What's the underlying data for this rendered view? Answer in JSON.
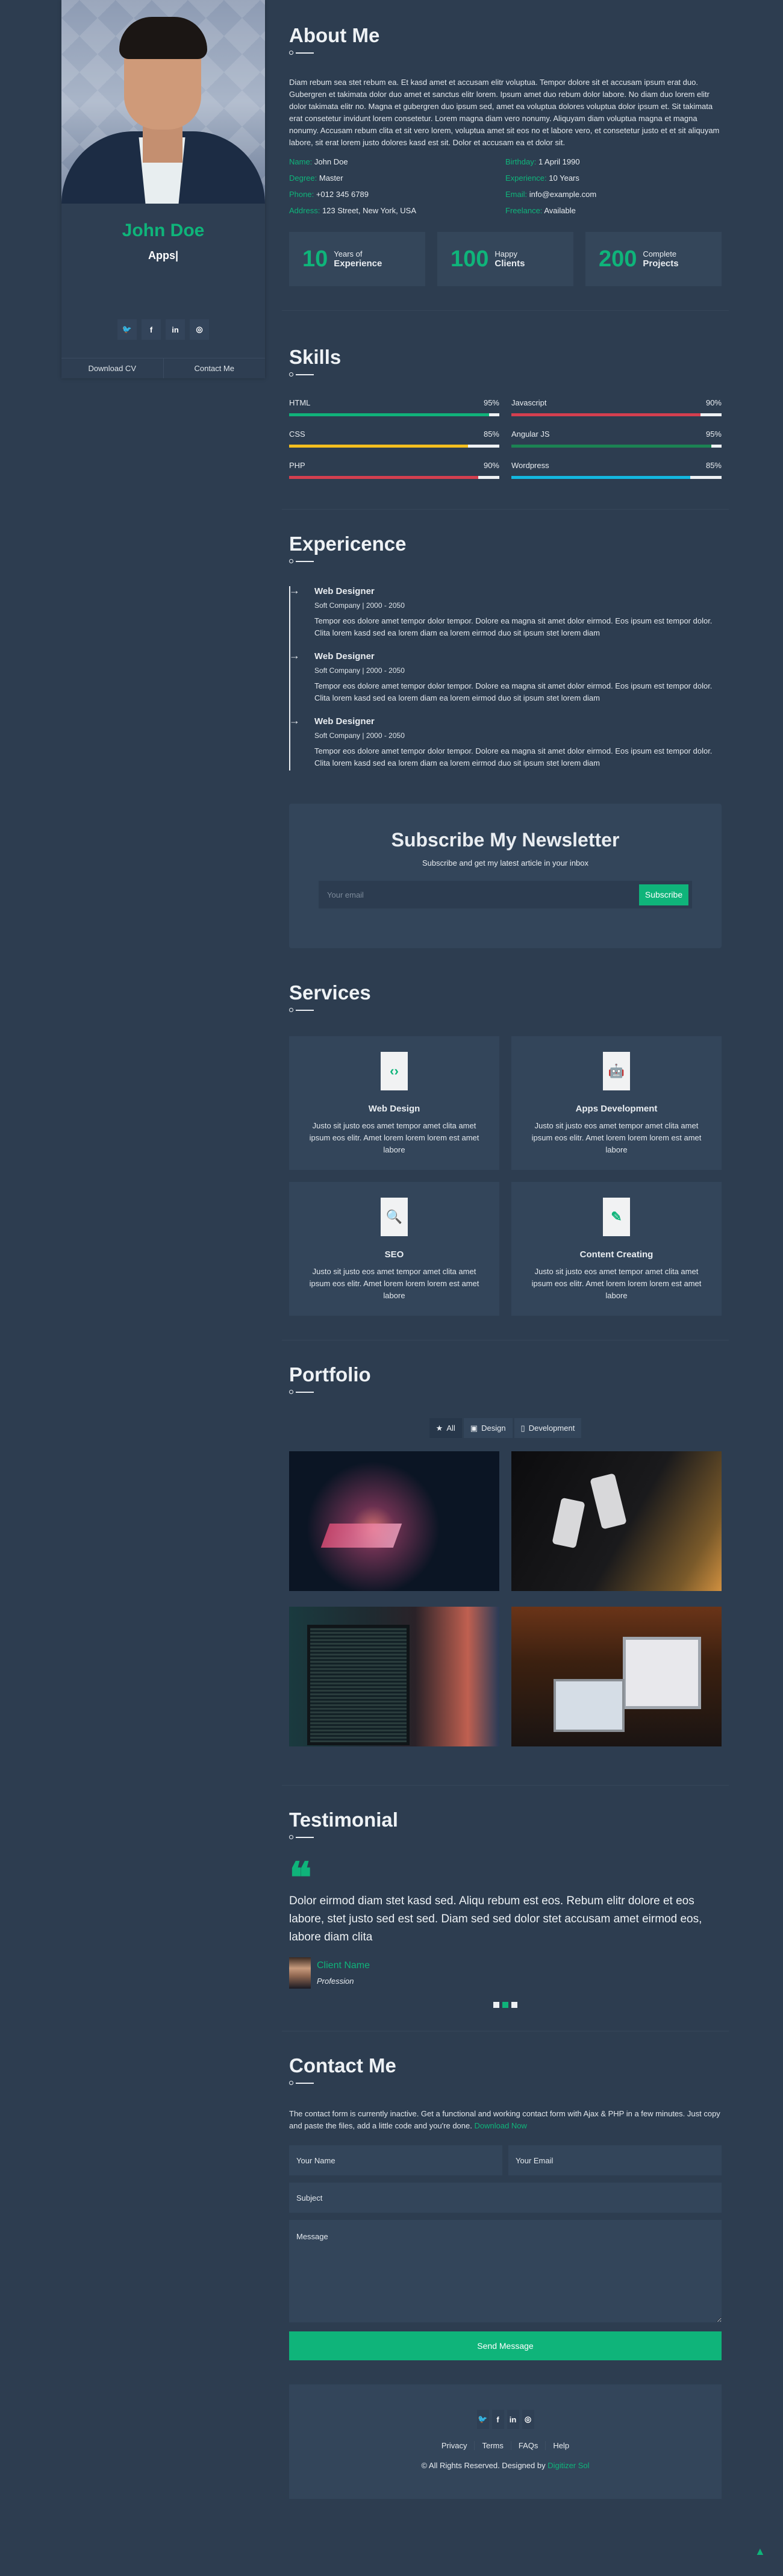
{
  "colors": {
    "accent": "#0fb47a",
    "background": "#2d3d50",
    "card": "#33455a"
  },
  "sidebar": {
    "name": "John Doe",
    "role": "Apps|",
    "social": [
      {
        "icon": "twitter-icon",
        "glyph": "🐦"
      },
      {
        "icon": "facebook-icon",
        "glyph": "f"
      },
      {
        "icon": "linkedin-icon",
        "glyph": "in"
      },
      {
        "icon": "instagram-icon",
        "glyph": "◎"
      }
    ],
    "download_cv": "Download CV",
    "contact_me": "Contact Me"
  },
  "about": {
    "title": "About Me",
    "text": "Diam rebum sea stet rebum ea. Et kasd amet et accusam elitr voluptua. Tempor dolore sit et accusam ipsum erat duo. Gubergren et takimata dolor duo amet et sanctus elitr lorem. Ipsum amet duo rebum dolor labore. No diam duo lorem elitr dolor takimata elitr no. Magna et gubergren duo ipsum sed, amet ea voluptua dolores voluptua dolor ipsum et. Sit takimata erat consetetur invidunt lorem consetetur. Lorem magna diam vero nonumy. Aliquyam diam voluptua magna et magna nonumy. Accusam rebum clita et sit vero lorem, voluptua amet sit eos no et labore vero, et consetetur justo et et sit aliquyam labore, sit erat lorem justo dolores kasd est sit. Dolor et accusam ea et dolor sit.",
    "info": [
      {
        "key": "Name:",
        "value": "John Doe"
      },
      {
        "key": "Birthday:",
        "value": "1 April 1990"
      },
      {
        "key": "Degree:",
        "value": "Master"
      },
      {
        "key": "Experience:",
        "value": "10 Years"
      },
      {
        "key": "Phone:",
        "value": "+012 345 6789"
      },
      {
        "key": "Email:",
        "value": "info@example.com"
      },
      {
        "key": "Address:",
        "value": "123 Street, New York, USA"
      },
      {
        "key": "Freelance:",
        "value": "Available"
      }
    ],
    "stats": [
      {
        "num": "10",
        "label1": "Years of",
        "label2": "Experience"
      },
      {
        "num": "100",
        "label1": "Happy",
        "label2": "Clients"
      },
      {
        "num": "200",
        "label1": "Complete",
        "label2": "Projects"
      }
    ]
  },
  "skills": {
    "title": "Skills",
    "items": [
      {
        "name": "HTML",
        "percent": 95,
        "label": "95%",
        "color": "#10b27a"
      },
      {
        "name": "Javascript",
        "percent": 90,
        "label": "90%",
        "color": "#d43f4f"
      },
      {
        "name": "CSS",
        "percent": 85,
        "label": "85%",
        "color": "#f4bf1f"
      },
      {
        "name": "Angular JS",
        "percent": 95,
        "label": "95%",
        "color": "#1c8353"
      },
      {
        "name": "PHP",
        "percent": 90,
        "label": "90%",
        "color": "#d43f4f"
      },
      {
        "name": "Wordpress",
        "percent": 85,
        "label": "85%",
        "color": "#13b8e0"
      }
    ]
  },
  "experience": {
    "title": "Expericence",
    "items": [
      {
        "job": "Web Designer",
        "company": "Soft Company | 2000 - 2050",
        "desc": "Tempor eos dolore amet tempor dolor tempor. Dolore ea magna sit amet dolor eirmod. Eos ipsum est tempor dolor. Clita lorem kasd sed ea lorem diam ea lorem eirmod duo sit ipsum stet lorem diam"
      },
      {
        "job": "Web Designer",
        "company": "Soft Company | 2000 - 2050",
        "desc": "Tempor eos dolore amet tempor dolor tempor. Dolore ea magna sit amet dolor eirmod. Eos ipsum est tempor dolor. Clita lorem kasd sed ea lorem diam ea lorem eirmod duo sit ipsum stet lorem diam"
      },
      {
        "job": "Web Designer",
        "company": "Soft Company | 2000 - 2050",
        "desc": "Tempor eos dolore amet tempor dolor tempor. Dolore ea magna sit amet dolor eirmod. Eos ipsum est tempor dolor. Clita lorem kasd sed ea lorem diam ea lorem eirmod duo sit ipsum stet lorem diam"
      }
    ]
  },
  "newsletter": {
    "title": "Subscribe My Newsletter",
    "subtitle": "Subscribe and get my latest article in your inbox",
    "placeholder": "Your email",
    "button": "Subscribe"
  },
  "services": {
    "title": "Services",
    "items": [
      {
        "icon": "laptop-code-icon",
        "glyph": "‹›",
        "title": "Web Design",
        "desc": "Justo sit justo eos amet tempor amet clita amet ipsum eos elitr. Amet lorem lorem lorem est amet labore"
      },
      {
        "icon": "android-icon",
        "glyph": "🤖",
        "title": "Apps Development",
        "desc": "Justo sit justo eos amet tempor amet clita amet ipsum eos elitr. Amet lorem lorem lorem est amet labore"
      },
      {
        "icon": "search-icon",
        "glyph": "🔍",
        "title": "SEO",
        "desc": "Justo sit justo eos amet tempor amet clita amet ipsum eos elitr. Amet lorem lorem lorem est amet labore"
      },
      {
        "icon": "edit-icon",
        "glyph": "✎",
        "title": "Content Creating",
        "desc": "Justo sit justo eos amet tempor amet clita amet ipsum eos elitr. Amet lorem lorem lorem est amet labore"
      }
    ]
  },
  "portfolio": {
    "title": "Portfolio",
    "filters": [
      {
        "label": "All",
        "icon": "star-icon",
        "glyph": "★",
        "active": true
      },
      {
        "label": "Design",
        "icon": "laptop-code-icon",
        "glyph": "▣",
        "active": false
      },
      {
        "label": "Development",
        "icon": "mobile-icon",
        "glyph": "▯",
        "active": false
      }
    ],
    "images": [
      {
        "name": "portfolio-image-phone-hand"
      },
      {
        "name": "portfolio-image-two-phones"
      },
      {
        "name": "portfolio-image-code-monitor"
      },
      {
        "name": "portfolio-image-designer-desk"
      }
    ]
  },
  "testimonial": {
    "title": "Testimonial",
    "quote_glyph": "❝",
    "text": "Dolor eirmod diam stet kasd sed. Aliqu rebum est eos. Rebum elitr dolore et eos labore, stet justo sed est sed. Diam sed sed dolor stet accusam amet eirmod eos, labore diam clita",
    "client_name": "Client Name",
    "profession": "Profession",
    "active_slide": 2,
    "slide_count": 3
  },
  "contact": {
    "title": "Contact Me",
    "note": "The contact form is currently inactive. Get a functional and working contact form with Ajax & PHP in a few minutes. Just copy and paste the files, add a little code and you're done. ",
    "note_link": "Download Now",
    "name_placeholder": "Your Name",
    "email_placeholder": "Your Email",
    "subject_placeholder": "Subject",
    "message_placeholder": "Message",
    "send": "Send Message"
  },
  "footer": {
    "links": [
      "Privacy",
      "Terms",
      "FAQs",
      "Help"
    ],
    "copyright": "© All Rights Reserved. Designed by ",
    "brand": "Digitizer Sol",
    "to_top_glyph": "▲"
  }
}
